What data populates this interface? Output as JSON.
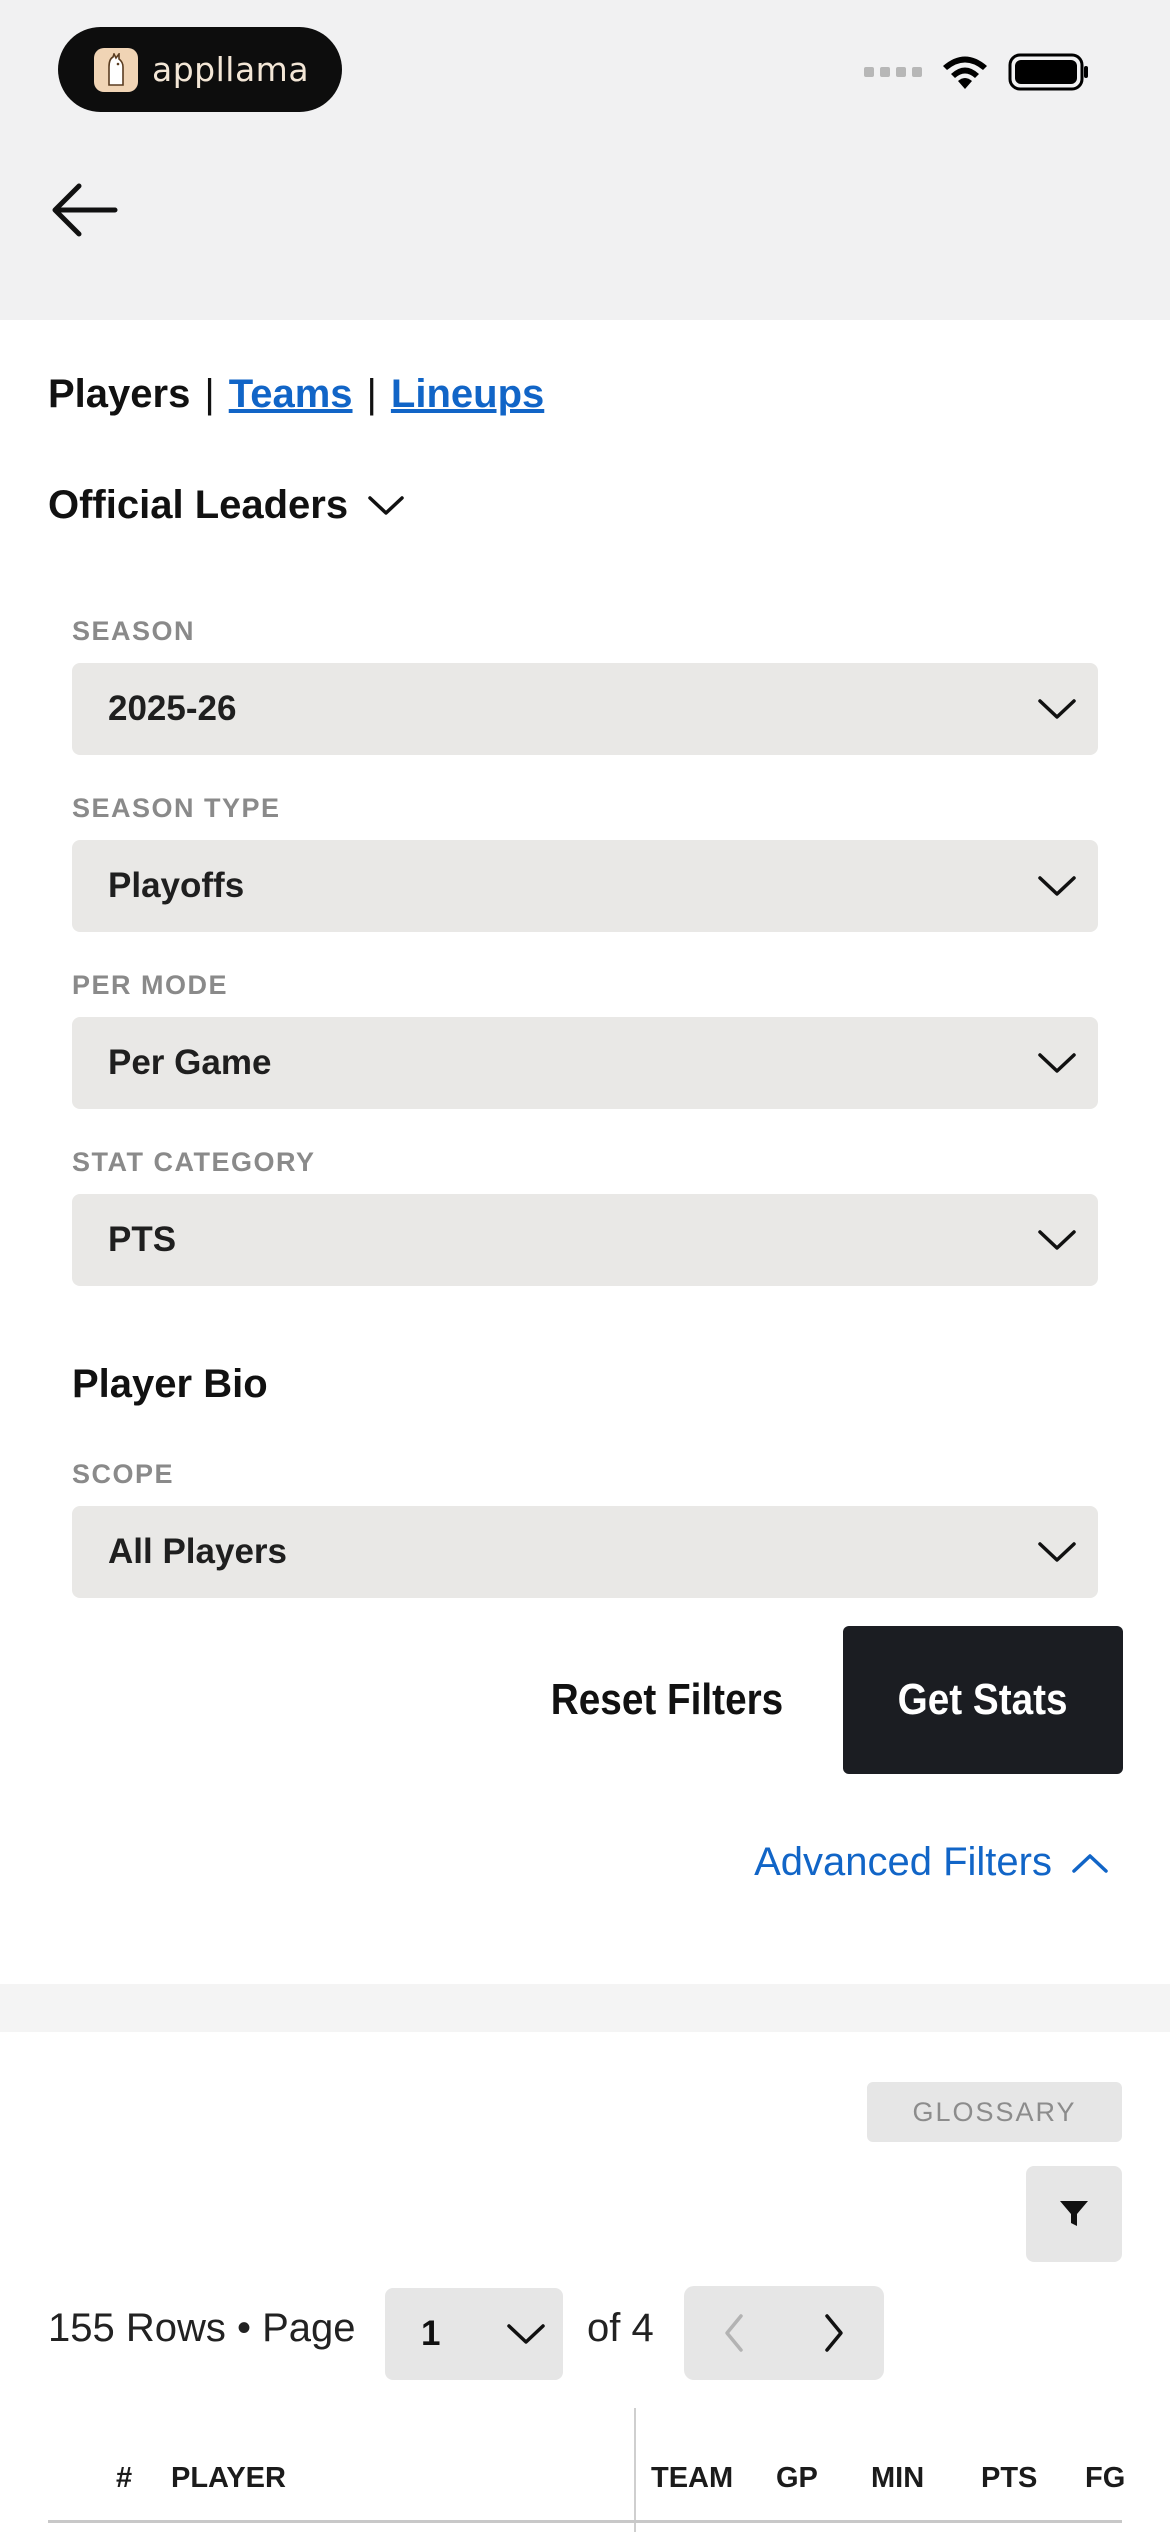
{
  "status_bar": {
    "app_pill_text": "appllama",
    "signal_icon": "signal-dots-icon",
    "wifi_icon": "wifi-icon",
    "battery_icon": "battery-icon"
  },
  "header": {
    "back_icon": "arrow-left-icon"
  },
  "nav_tabs": {
    "active": "Players",
    "separator": "|",
    "teams": "Teams",
    "lineups": "Lineups"
  },
  "leaders_dropdown": {
    "label": "Official Leaders"
  },
  "filters": {
    "season": {
      "label": "SEASON",
      "value": "2025-26"
    },
    "season_type": {
      "label": "SEASON TYPE",
      "value": "Playoffs"
    },
    "per_mode": {
      "label": "PER MODE",
      "value": "Per Game"
    },
    "stat_category": {
      "label": "STAT CATEGORY",
      "value": "PTS"
    }
  },
  "player_bio": {
    "heading": "Player Bio",
    "scope": {
      "label": "SCOPE",
      "value": "All Players"
    }
  },
  "actions": {
    "reset": "Reset Filters",
    "get_stats": "Get Stats",
    "advanced": "Advanced Filters"
  },
  "table_controls": {
    "glossary": "GLOSSARY",
    "rows_text": "155 Rows • Page",
    "page_value": "1",
    "of_text": "of 4"
  },
  "table": {
    "columns": [
      "#",
      "PLAYER",
      "TEAM",
      "GP",
      "MIN",
      "PTS",
      "FG"
    ]
  },
  "colors": {
    "link": "#1165c7",
    "dark_button": "#1b1d22",
    "select_bg": "#e9e8e6"
  }
}
